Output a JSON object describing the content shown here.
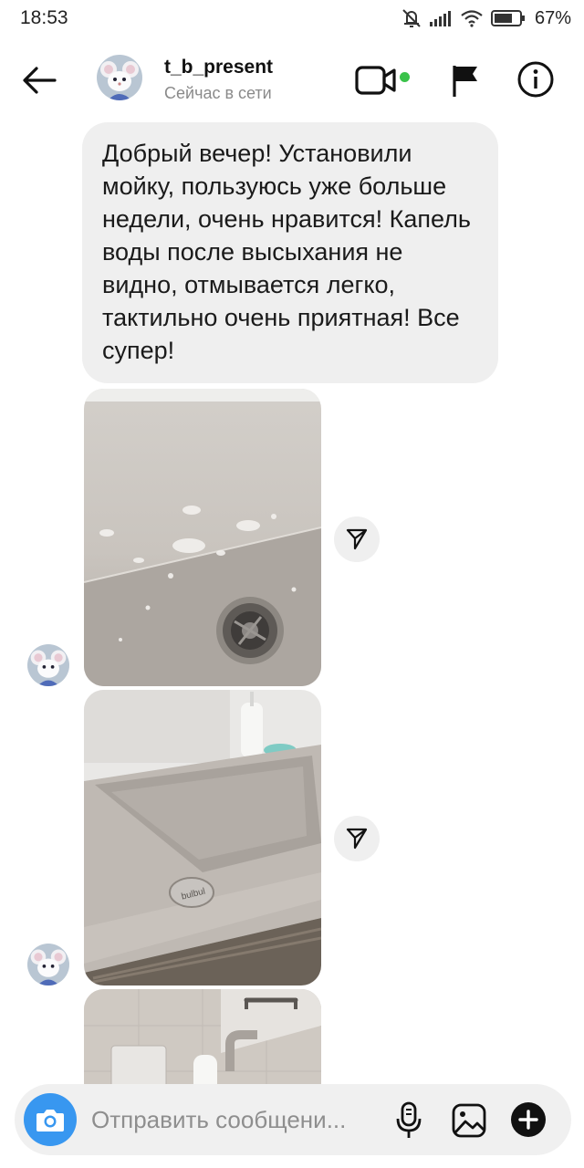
{
  "status_bar": {
    "time": "18:53",
    "battery": "67%",
    "icons": [
      "bell-muted-icon",
      "signal-icon",
      "wifi-icon",
      "battery-icon"
    ]
  },
  "header": {
    "username": "t_b_present",
    "status": "Сейчас в сети",
    "icons": [
      "back-arrow-icon",
      "video-call-icon",
      "flag-icon",
      "info-icon"
    ],
    "online_color": "#3ac24a"
  },
  "messages": [
    {
      "type": "text",
      "text": "Добрый вечер! Установили мойку, пользуюсь уже больше недели, очень нравится! Капель воды после высыхания не видно, отмывается легко, тактильно очень приятная! Все супер!"
    },
    {
      "type": "photo",
      "description": "sink-closeup-drops"
    },
    {
      "type": "photo",
      "description": "sink-bowl",
      "logo_text": "bulbul"
    },
    {
      "type": "photo",
      "description": "sink-with-faucet"
    }
  ],
  "composer": {
    "placeholder": "Отправить сообщени...",
    "icons": [
      "camera-icon",
      "microphone-icon",
      "gallery-icon",
      "plus-icon"
    ],
    "camera_color": "#3897f0"
  }
}
